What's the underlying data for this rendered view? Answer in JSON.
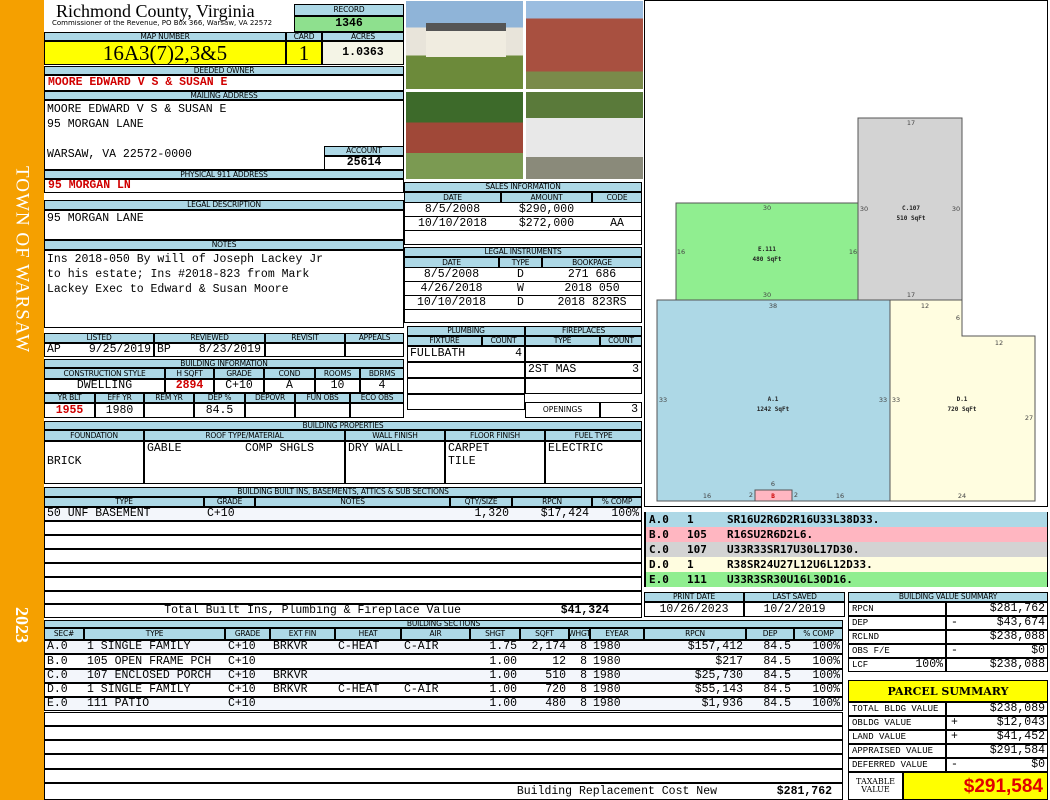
{
  "sidebar": {
    "town": "TOWN OF WARSAW",
    "year": "2023"
  },
  "header": {
    "county": "Richmond County, Virginia",
    "office": "Commissioner of the Revenue, PO Box 366, Warsaw, VA 22572",
    "record_label": "RECORD",
    "record": "1346",
    "map_label": "MAP NUMBER",
    "map": "16A3(7)2,3&5",
    "card_label": "CARD",
    "card": "1",
    "acres_label": "ACRES",
    "acres": "1.0363"
  },
  "owner": {
    "label": "DEEDED OWNER",
    "name": "MOORE EDWARD V S & SUSAN E"
  },
  "mailing": {
    "label": "MAILING ADDRESS",
    "lines": [
      "MOORE EDWARD V S & SUSAN E",
      "95 MORGAN LANE",
      "WARSAW, VA 22572-0000"
    ],
    "account_label": "ACCOUNT",
    "account": "25614"
  },
  "physical": {
    "label": "PHYSICAL 911 ADDRESS",
    "value": "95 MORGAN LN"
  },
  "legal": {
    "label": "LEGAL DESCRIPTION",
    "value": "95 MORGAN LANE"
  },
  "notes": {
    "label": "NOTES",
    "lines": [
      "Ins 2018-050 By will of Joseph Lackey Jr",
      "to his estate; Ins #2018-823 from Mark",
      "Lackey Exec to Edward & Susan Moore"
    ]
  },
  "review": {
    "headers": [
      "LISTED",
      "REVIEWED",
      "REVISIT",
      "APPEALS"
    ],
    "listed_by": "AP",
    "listed": "9/25/2019",
    "reviewed_by": "BP",
    "reviewed": "8/23/2019"
  },
  "building_info": {
    "label": "BUILDING INFORMATION",
    "headers1": [
      "CONSTRUCTION STYLE",
      "H SQFT",
      "GRADE",
      "COND",
      "ROOMS",
      "BDRMS"
    ],
    "values1": [
      "DWELLING",
      "2894",
      "C+10",
      "A",
      "10",
      "4"
    ],
    "headers2": [
      "YR BLT",
      "EFF YR",
      "REM YR",
      "DEP %",
      "DEPOVR",
      "FUN OBS",
      "ECO OBS"
    ],
    "values2": [
      "1955",
      "1980",
      "",
      "84.5",
      "",
      "",
      ""
    ]
  },
  "sales": {
    "label": "SALES INFORMATION",
    "headers": [
      "DATE",
      "AMOUNT",
      "CODE"
    ],
    "rows": [
      [
        "8/5/2008",
        "$290,000",
        ""
      ],
      [
        "10/10/2018",
        "$272,000",
        "AA"
      ]
    ]
  },
  "instruments": {
    "label": "LEGAL INSTRUMENTS",
    "headers": [
      "DATE",
      "TYPE",
      "BOOKPAGE"
    ],
    "rows": [
      [
        "8/5/2008",
        "D",
        "271 686"
      ],
      [
        "4/26/2018",
        "W",
        "2018 050"
      ],
      [
        "10/10/2018",
        "D",
        "2018 823RS"
      ]
    ]
  },
  "plumbing": {
    "label": "PLUMBING",
    "headers": [
      "FIXTURE",
      "COUNT"
    ],
    "rows": [
      [
        "FULLBATH",
        "4"
      ]
    ]
  },
  "fireplaces": {
    "label": "FIREPLACES",
    "headers": [
      "TYPE",
      "COUNT"
    ],
    "rows": [
      [
        "2ST MAS",
        "3"
      ]
    ],
    "openings_label": "OPENINGS",
    "openings": "3"
  },
  "properties": {
    "label": "BUILDING PROPERTIES",
    "headers": [
      "FOUNDATION",
      "ROOF TYPE/MATERIAL",
      "WALL FINISH",
      "FLOOR FINISH",
      "FUEL TYPE"
    ],
    "foundation": "BRICK",
    "roof_type": "GABLE",
    "roof_material": "COMP SHGLS",
    "wall": "DRY WALL",
    "floor": [
      "CARPET",
      "TILE"
    ],
    "fuel": "ELECTRIC"
  },
  "builtins": {
    "label": "BUILDING BUILT INS, BASEMENTS, ATTICS & SUB SECTIONS",
    "headers": [
      "TYPE",
      "GRADE",
      "NOTES",
      "QTY/SIZE",
      "RPCN",
      "% COMP"
    ],
    "rows": [
      [
        "50 UNF BASEMENT",
        "C+10",
        "",
        "1,320",
        "$17,424",
        "100%"
      ]
    ],
    "total_label": "Total Built Ins, Plumbing & Fireplace Value",
    "total": "$41,324"
  },
  "sections": {
    "label": "BUILDING SECTIONS",
    "headers": [
      "SEC#",
      "TYPE",
      "GRADE",
      "EXT FIN",
      "HEAT",
      "AIR",
      "SHGT",
      "SQFT",
      "WHGT",
      "EYEAR",
      "RPCN",
      "DEP",
      "% COMP"
    ],
    "rows": [
      [
        "A.0",
        "1 SINGLE FAMILY",
        "C+10",
        "BRKVR",
        "C-HEAT",
        "C-AIR",
        "1.75",
        "2,174",
        "8",
        "1980",
        "$157,412",
        "84.5",
        "100%"
      ],
      [
        "B.0",
        "105 OPEN FRAME PCH",
        "C+10",
        "",
        "",
        "",
        "1.00",
        "12",
        "8",
        "1980",
        "$217",
        "84.5",
        "100%"
      ],
      [
        "C.0",
        "107 ENCLOSED PORCH",
        "C+10",
        "BRKVR",
        "",
        "",
        "1.00",
        "510",
        "8",
        "1980",
        "$25,730",
        "84.5",
        "100%"
      ],
      [
        "D.0",
        "1 SINGLE FAMILY",
        "C+10",
        "BRKVR",
        "C-HEAT",
        "C-AIR",
        "1.00",
        "720",
        "8",
        "1980",
        "$55,143",
        "84.5",
        "100%"
      ],
      [
        "E.0",
        "111 PATIO",
        "C+10",
        "",
        "",
        "",
        "1.00",
        "480",
        "8",
        "1980",
        "$1,936",
        "84.5",
        "100%"
      ]
    ],
    "total_label": "Building Replacement Cost New",
    "total": "$281,762"
  },
  "sketch": {
    "A": {
      "id": "A.1",
      "area": "1242 SqFt",
      "dims": [
        "38",
        "33",
        "33",
        "16",
        "16"
      ]
    },
    "B": {
      "id": "B",
      "dims": [
        "6",
        "2",
        "2"
      ]
    },
    "C": {
      "id": "C.107",
      "area": "510 SqFt",
      "dims": [
        "17",
        "30",
        "30",
        "17"
      ]
    },
    "D": {
      "id": "D.1",
      "area": "720 SqFt",
      "dims": [
        "12",
        "6",
        "12",
        "33",
        "27",
        "24"
      ]
    },
    "E": {
      "id": "E.111",
      "area": "480 SqFt",
      "dims": [
        "30",
        "16",
        "16",
        "30"
      ]
    }
  },
  "codes": [
    {
      "sec": "A.0",
      "code": "1",
      "path": "SR16U2R6D2R16U33L38D33.",
      "color": "#add8e6"
    },
    {
      "sec": "B.0",
      "code": "105",
      "path": "R16SU2R6D2L6.",
      "color": "#ffb6c1"
    },
    {
      "sec": "C.0",
      "code": "107",
      "path": "U33R33SR17U30L17D30.",
      "color": "#d3d3d3"
    },
    {
      "sec": "D.0",
      "code": "1",
      "path": "R38SR24U27L12U6L12D33.",
      "color": "#fffde0"
    },
    {
      "sec": "E.0",
      "code": "111",
      "path": "U33R3SR30U16L30D16.",
      "color": "#90ee90"
    }
  ],
  "dates": {
    "print_label": "PRINT DATE",
    "print": "10/26/2023",
    "saved_label": "LAST SAVED",
    "saved": "10/2/2019"
  },
  "value_summary": {
    "label": "BUILDING VALUE SUMMARY",
    "rows": [
      {
        "label": "RPCN",
        "sign": "",
        "value": "$281,762"
      },
      {
        "label": "DEP",
        "sign": "-",
        "value": "$43,674"
      },
      {
        "label": "RCLND",
        "sign": "",
        "value": "$238,088"
      },
      {
        "label": "OBS F/E",
        "sign": "-",
        "value": "$0"
      },
      {
        "label": "LCF",
        "pct": "100%",
        "sign": "",
        "value": "$238,088"
      }
    ]
  },
  "parcel": {
    "title": "PARCEL SUMMARY",
    "rows": [
      {
        "label": "TOTAL BLDG VALUE",
        "sign": "",
        "value": "$238,089"
      },
      {
        "label": "OBLDG VALUE",
        "sign": "+",
        "value": "$12,043"
      },
      {
        "label": "LAND VALUE",
        "sign": "+",
        "value": "$41,452"
      },
      {
        "label": "APPRAISED VALUE",
        "sign": "",
        "value": "$291,584"
      },
      {
        "label": "DEFERRED VALUE",
        "sign": "-",
        "value": "$0"
      }
    ],
    "taxable_label": "TAXABLE VALUE",
    "taxable": "$291,584"
  }
}
